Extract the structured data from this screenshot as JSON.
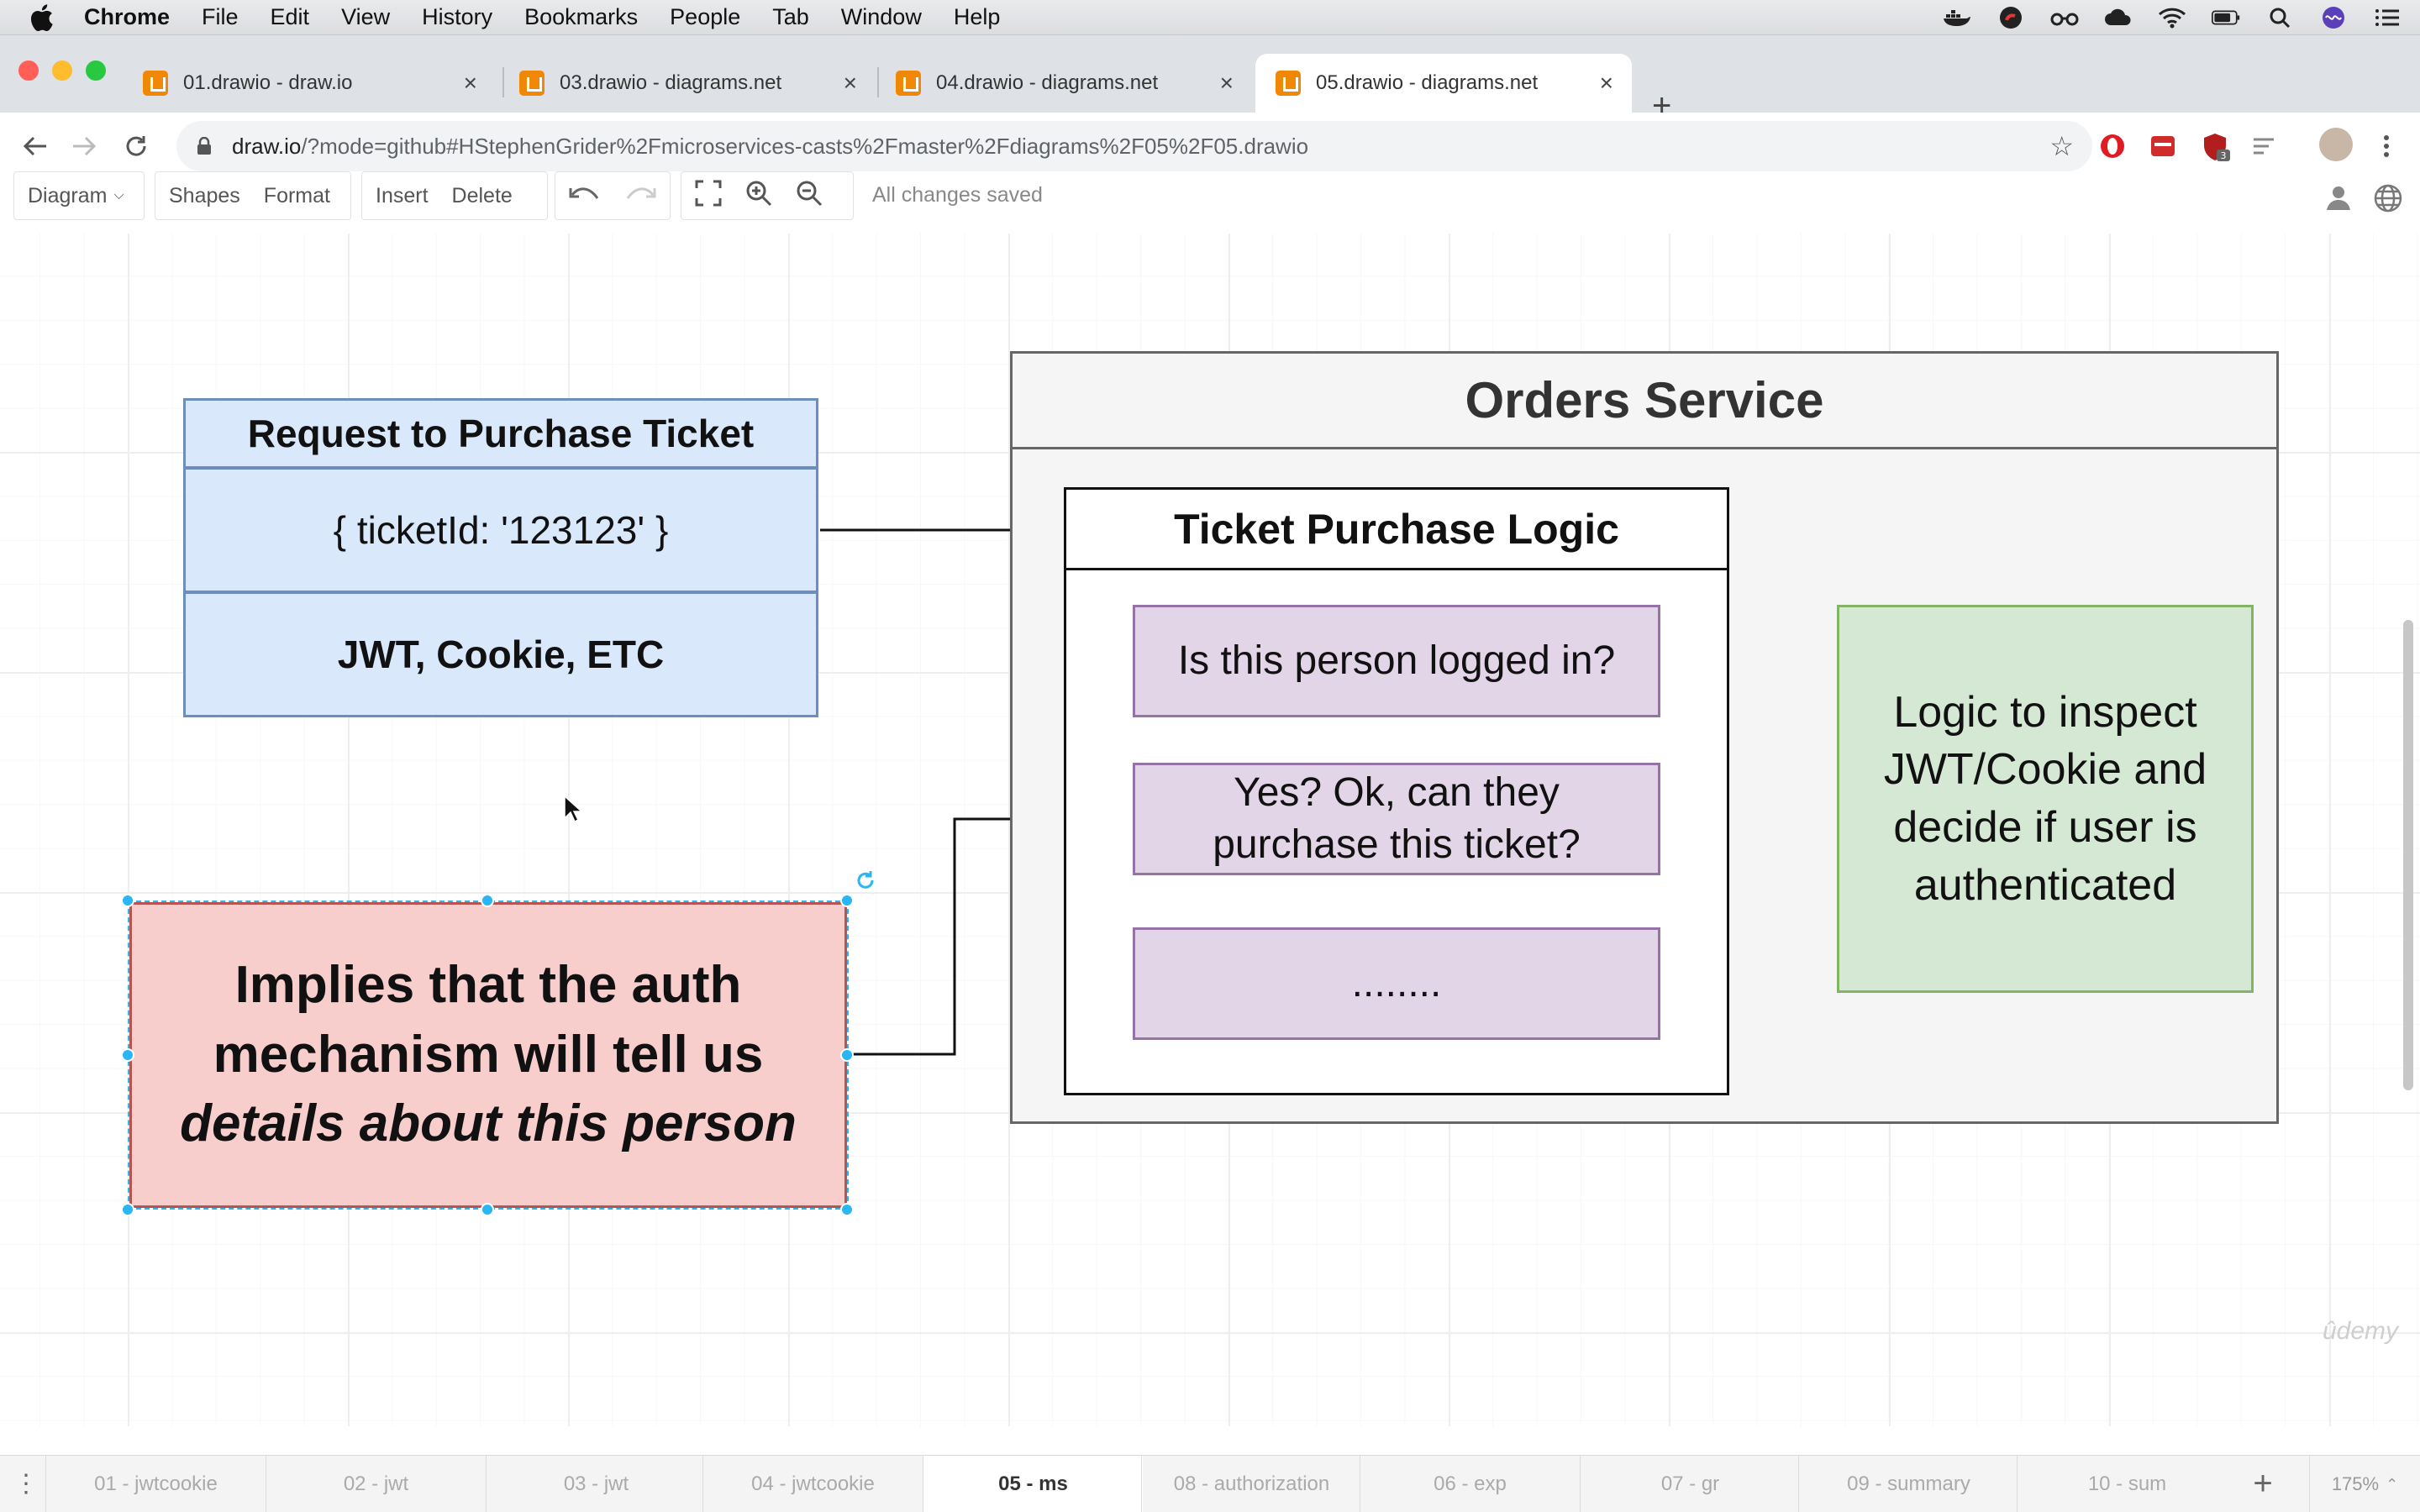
{
  "menubar": {
    "app": "Chrome",
    "items": [
      "File",
      "Edit",
      "View",
      "History",
      "Bookmarks",
      "People",
      "Tab",
      "Window",
      "Help"
    ],
    "tray_icons": [
      "docker-icon",
      "sync-icon",
      "glasses-icon",
      "cloud-icon",
      "wifi-icon",
      "battery-icon",
      "search-icon",
      "siri-icon",
      "list-icon"
    ]
  },
  "tabs": [
    {
      "title": "01.drawio - draw.io"
    },
    {
      "title": "03.drawio - diagrams.net"
    },
    {
      "title": "04.drawio - diagrams.net"
    },
    {
      "title": "05.drawio - diagrams.net",
      "active": true
    }
  ],
  "address": {
    "host": "draw.io",
    "path": "/?mode=github#HStephenGrider%2Fmicroservices-casts%2Fmaster%2Fdiagrams%2F05%2F05.drawio"
  },
  "toolbar": {
    "diagram": "Diagram",
    "shapes": "Shapes",
    "format": "Format",
    "insert": "Insert",
    "delete": "Delete",
    "status": "All changes saved"
  },
  "diagram": {
    "request_title": "Request to Purchase Ticket",
    "request_body": "{ ticketId: '123123' }",
    "request_auth": "JWT, Cookie, ETC",
    "orders_title": "Orders Service",
    "logic_title": "Ticket Purchase Logic",
    "step1": "Is this person logged in?",
    "step2_line1": "Yes? Ok, can they",
    "step2_line2": "purchase this ticket?",
    "step3": "........",
    "inspect_line1": "Logic to inspect",
    "inspect_line2": "JWT/Cookie and",
    "inspect_line3": "decide if user is",
    "inspect_line4": "authenticated",
    "implies_line1": "Implies that the auth",
    "implies_line2": "mechanism will tell us",
    "implies_line3": "details about this person",
    "colors": {
      "blue_fill": "#dae8fc",
      "blue_stroke": "#6c8ebf",
      "purple_fill": "#e1d5e7",
      "purple_stroke": "#9673a6",
      "green_fill": "#d5e8d4",
      "green_stroke": "#82b366",
      "red_fill": "#f8cecc",
      "red_stroke": "#b85450",
      "selection": "#29b6f2"
    }
  },
  "watermark": "ûdemy",
  "pages": [
    {
      "label": "01 - jwtcookie"
    },
    {
      "label": "02 - jwt"
    },
    {
      "label": "03 - jwt"
    },
    {
      "label": "04 - jwtcookie"
    },
    {
      "label": "05 - ms",
      "active": true
    },
    {
      "label": "08 - authorization"
    },
    {
      "label": "06 - exp"
    },
    {
      "label": "07 - gr"
    },
    {
      "label": "09 - summary"
    },
    {
      "label": "10 - sum"
    }
  ],
  "zoom": "175%"
}
